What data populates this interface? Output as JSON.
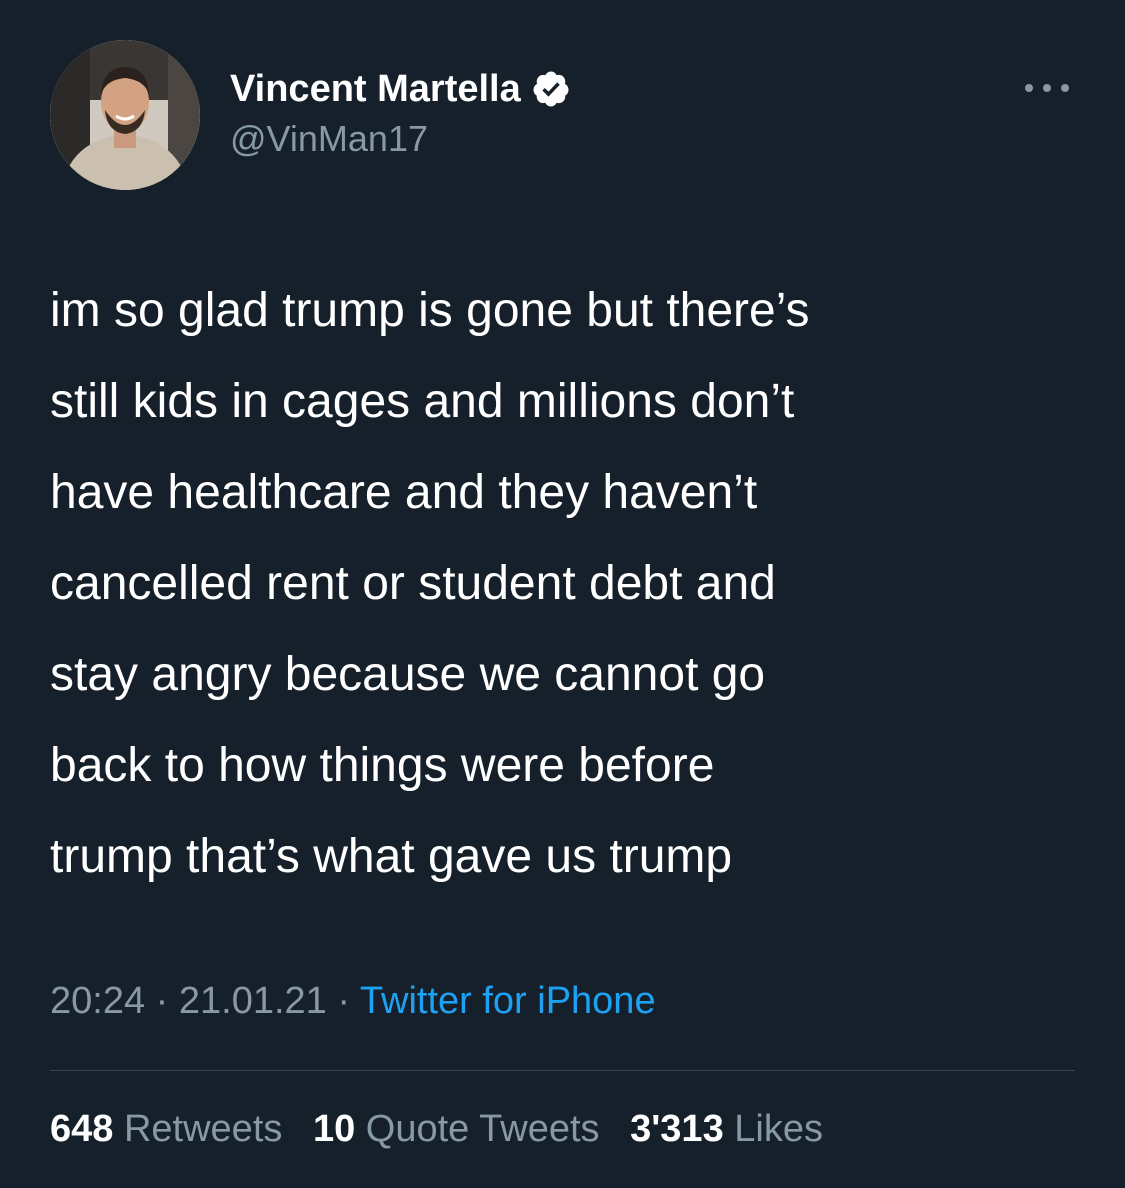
{
  "author": {
    "display_name": "Vincent Martella",
    "handle": "@VinMan17",
    "verified": true,
    "avatar_icon": "profile-photo"
  },
  "tweet": {
    "text": "im so glad trump is gone but there’s\nstill kids in cages and millions don’t\nhave healthcare and they haven’t\ncancelled rent or student debt and\nstay angry because we cannot go\nback to how things were before\ntrump that’s what gave us trump",
    "time": "20:24",
    "date": "21.01.21",
    "separator": " · ",
    "source": "Twitter for iPhone"
  },
  "stats": {
    "retweets_count": "648",
    "retweets_label": "Retweets",
    "quotes_count": "10",
    "quotes_label": "Quote Tweets",
    "likes_count": "3'313",
    "likes_label": "Likes"
  },
  "colors": {
    "background": "#15202b",
    "text": "#ffffff",
    "secondary": "#8899a6",
    "accent": "#1da1f2",
    "divider": "#38444d"
  }
}
